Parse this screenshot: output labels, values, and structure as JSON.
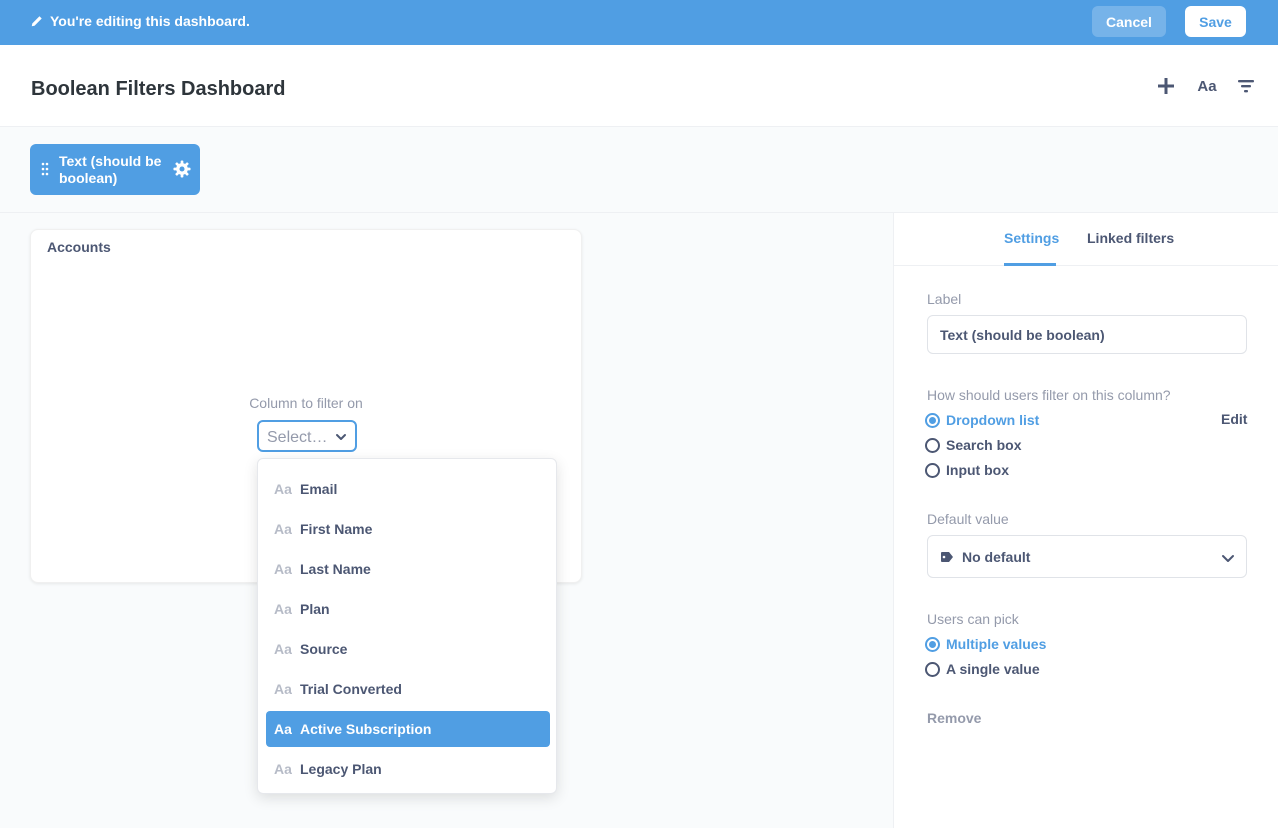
{
  "edit_bar": {
    "message": "You're editing this dashboard.",
    "cancel_label": "Cancel",
    "save_label": "Save"
  },
  "header": {
    "title": "Boolean Filters Dashboard",
    "text_icon_label": "Aa"
  },
  "filter_chip": {
    "label": "Text (should be boolean)"
  },
  "card": {
    "title": "Accounts",
    "column_filter_label": "Column to filter on",
    "select_placeholder": "Select…"
  },
  "dropdown": {
    "type_icon": "Aa",
    "options": [
      {
        "label": "Email",
        "selected": false
      },
      {
        "label": "First Name",
        "selected": false
      },
      {
        "label": "Last Name",
        "selected": false
      },
      {
        "label": "Plan",
        "selected": false
      },
      {
        "label": "Source",
        "selected": false
      },
      {
        "label": "Trial Converted",
        "selected": false
      },
      {
        "label": "Active Subscription",
        "selected": true
      },
      {
        "label": "Legacy Plan",
        "selected": false
      }
    ]
  },
  "sidebar": {
    "tabs": [
      "Settings",
      "Linked filters"
    ],
    "active_tab": "Settings",
    "label_heading": "Label",
    "label_value": "Text (should be boolean)",
    "filter_method_heading": "How should users filter on this column?",
    "filter_methods": [
      "Dropdown list",
      "Search box",
      "Input box"
    ],
    "filter_method_selected": "Dropdown list",
    "edit_label": "Edit",
    "default_heading": "Default value",
    "default_value": "No default",
    "pick_heading": "Users can pick",
    "pick_options": [
      "Multiple values",
      "A single value"
    ],
    "pick_selected": "Multiple values",
    "remove_label": "Remove"
  },
  "colors": {
    "brand": "#509ee3",
    "text_dark": "#2e353b",
    "text": "#4c5773",
    "text_muted": "#949aab"
  }
}
